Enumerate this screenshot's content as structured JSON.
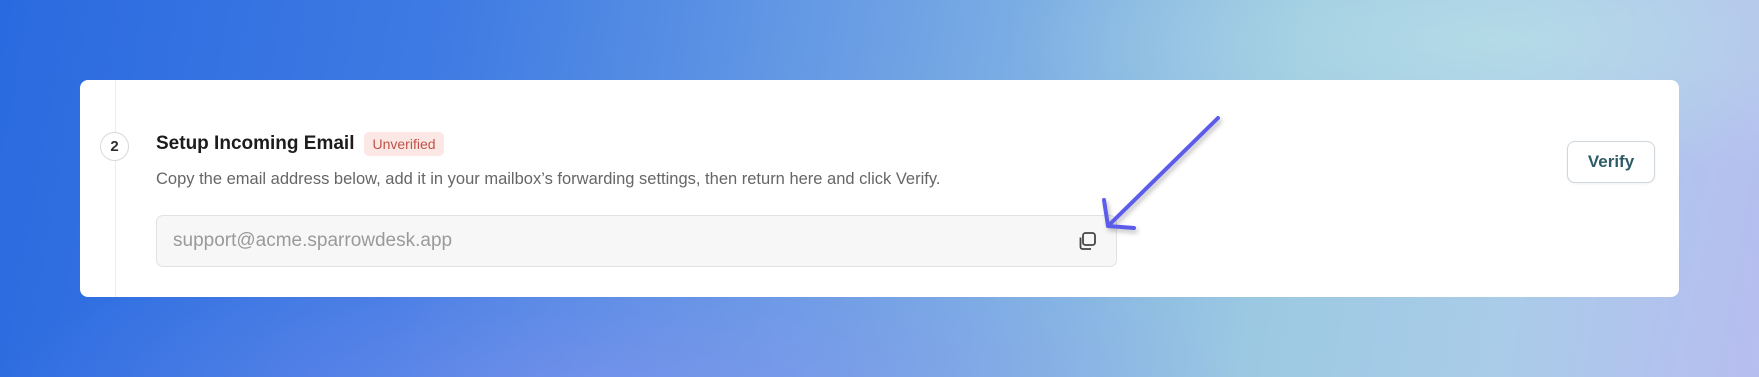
{
  "step": {
    "number": "2",
    "title": "Setup Incoming Email",
    "status_badge": "Unverified",
    "description": "Copy the email address below, add it in your mailbox’s forwarding settings, then return here and click Verify."
  },
  "email_field": {
    "value": "support@acme.sparrowdesk.app",
    "copy_icon": "copy-icon"
  },
  "actions": {
    "verify_label": "Verify"
  },
  "colors": {
    "badge_text": "#c0534a",
    "badge_bg": "#fbe8e4",
    "verify_text": "#2e5c66",
    "arrow": "#5b5bea"
  }
}
